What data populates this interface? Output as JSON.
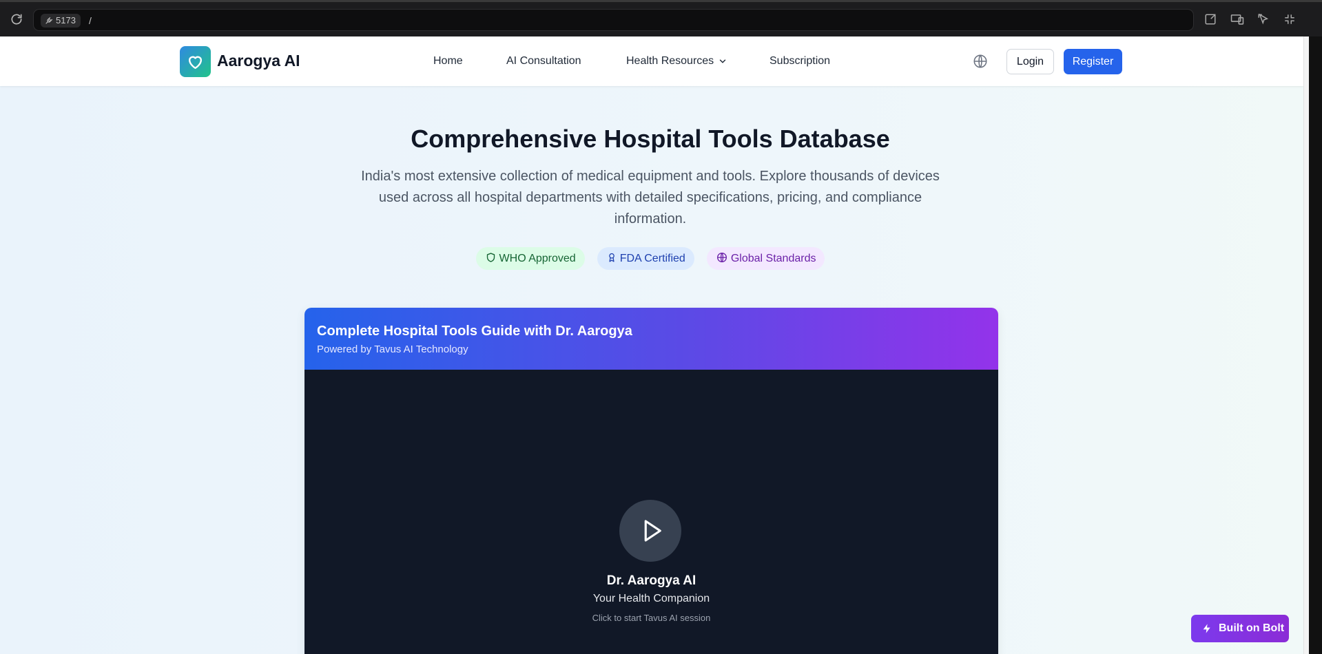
{
  "browser": {
    "port_label": "5173",
    "url_path": "/"
  },
  "navbar": {
    "brand": "Aarogya AI",
    "links": [
      {
        "label": "Home"
      },
      {
        "label": "AI Consultation"
      },
      {
        "label": "Health Resources"
      },
      {
        "label": "Subscription"
      }
    ],
    "login_label": "Login",
    "register_label": "Register"
  },
  "hero": {
    "title": "Comprehensive Hospital Tools Database",
    "description": "India's most extensive collection of medical equipment and tools. Explore thousands of devices used across all hospital departments with detailed specifications, pricing, and compliance information.",
    "badges": [
      {
        "label": "WHO Approved",
        "icon": "shield-icon"
      },
      {
        "label": "FDA Certified",
        "icon": "award-icon"
      },
      {
        "label": "Global Standards",
        "icon": "globe-icon"
      }
    ]
  },
  "video_card": {
    "title": "Complete Hospital Tools Guide with Dr. Aarogya",
    "subtitle": "Powered by Tavus AI Technology",
    "assistant_name": "Dr. Aarogya AI",
    "assistant_role": "Your Health Companion",
    "hint": "Click to start Tavus AI session"
  },
  "bolt_badge": {
    "label": "Built on Bolt"
  },
  "colors": {
    "primary": "#2563eb",
    "gradient_start": "#2563eb",
    "gradient_end": "#9333ea",
    "video_bg": "#111827",
    "bolt_purple": "#7c3aed"
  }
}
